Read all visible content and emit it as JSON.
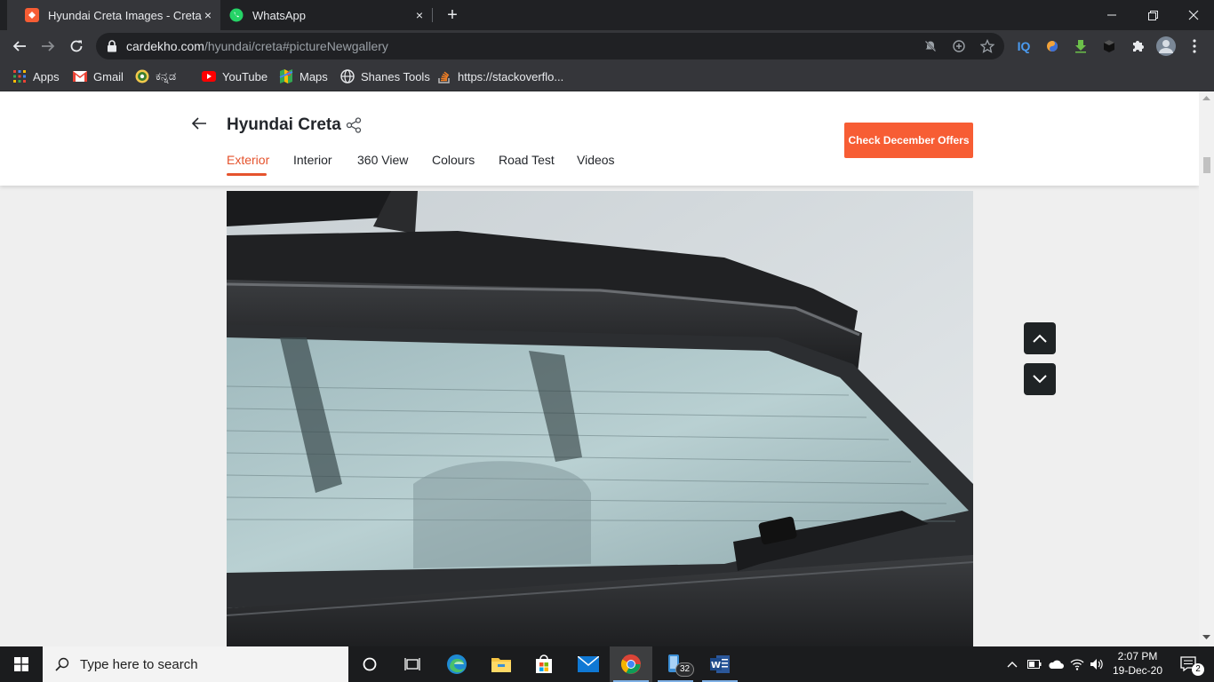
{
  "browser": {
    "tabs": [
      {
        "title": "Hyundai Creta Images - Creta Interior & Exterior Photos",
        "close": "×"
      },
      {
        "title": "WhatsApp",
        "close": "×"
      }
    ],
    "new_tab": "+",
    "url_host": "cardekho.com",
    "url_path": "/hyundai/creta#pictureNewgallery",
    "bookmarks": [
      {
        "label": "Apps",
        "icon": "apps-grid-icon"
      },
      {
        "label": "Gmail",
        "icon": "gmail-icon"
      },
      {
        "label": "ಕನ್ನಡ",
        "icon": "kannada-site-icon"
      },
      {
        "label": "YouTube",
        "icon": "youtube-icon"
      },
      {
        "label": "Maps",
        "icon": "maps-icon"
      },
      {
        "label": "Shanes Tools",
        "icon": "globe-icon"
      },
      {
        "label": "https://stackoverflo...",
        "icon": "stackoverflow-icon"
      }
    ]
  },
  "page": {
    "title": "Hyundai Creta",
    "tabs": [
      {
        "label": "Exterior",
        "active": true
      },
      {
        "label": "Interior",
        "active": false
      },
      {
        "label": "360 View",
        "active": false
      },
      {
        "label": "Colours",
        "active": false
      },
      {
        "label": "Road Test",
        "active": false
      },
      {
        "label": "Videos",
        "active": false
      }
    ],
    "offers_button": "Check December Offers",
    "accent_color": "#f75d34",
    "image_subject": "Hyundai Creta rear windshield and spoiler"
  },
  "taskbar": {
    "search_placeholder": "Type here to search",
    "badge_count": "32",
    "time": "2:07 PM",
    "date": "19-Dec-20",
    "notification_count": "2"
  }
}
